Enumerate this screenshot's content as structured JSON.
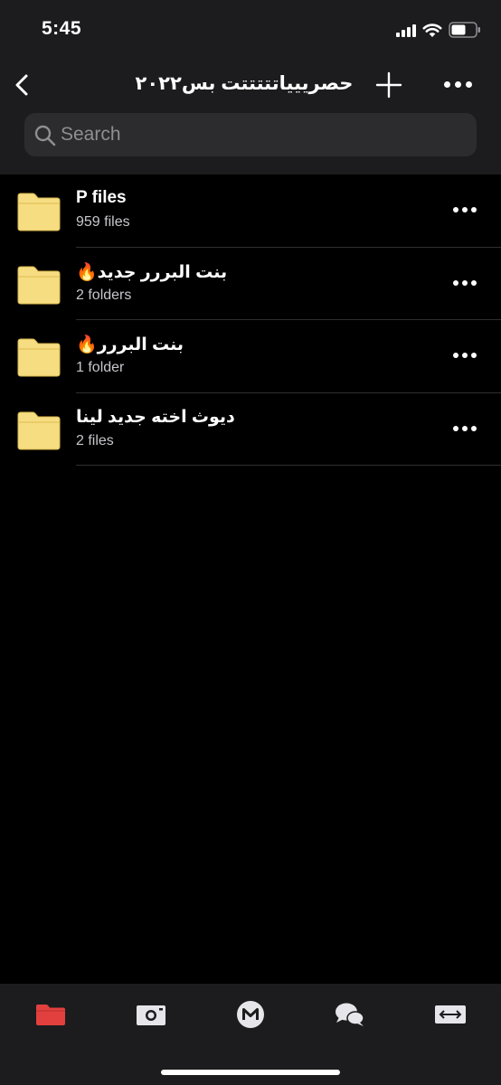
{
  "status_bar": {
    "time": "5:45"
  },
  "nav": {
    "title": "حصرييياتتتتتت بس٢٠٢٢"
  },
  "search": {
    "placeholder": "Search"
  },
  "folders": [
    {
      "name": "P files",
      "subtitle": "959 files",
      "rtl": false
    },
    {
      "name": "بنت البررر جديد🔥",
      "subtitle": "2 folders",
      "rtl": true
    },
    {
      "name": "بنت البررر🔥",
      "subtitle": "1 folder",
      "rtl": true
    },
    {
      "name": "ديوث اخته جديد لينا",
      "subtitle": "2 files",
      "rtl": true
    }
  ],
  "tabs": [
    {
      "icon": "cloud-drive-folder-icon",
      "active": true
    },
    {
      "icon": "camera-uploads-icon",
      "active": false
    },
    {
      "icon": "mega-home-icon",
      "active": false
    },
    {
      "icon": "chat-icon",
      "active": false
    },
    {
      "icon": "transfers-icon",
      "active": false
    }
  ],
  "colors": {
    "background": "#000000",
    "header": "#1c1c1e",
    "search_field": "#2c2c2e",
    "folder": "#f6dd82",
    "accent_red": "#e2403f",
    "divider": "#2f2f31"
  }
}
